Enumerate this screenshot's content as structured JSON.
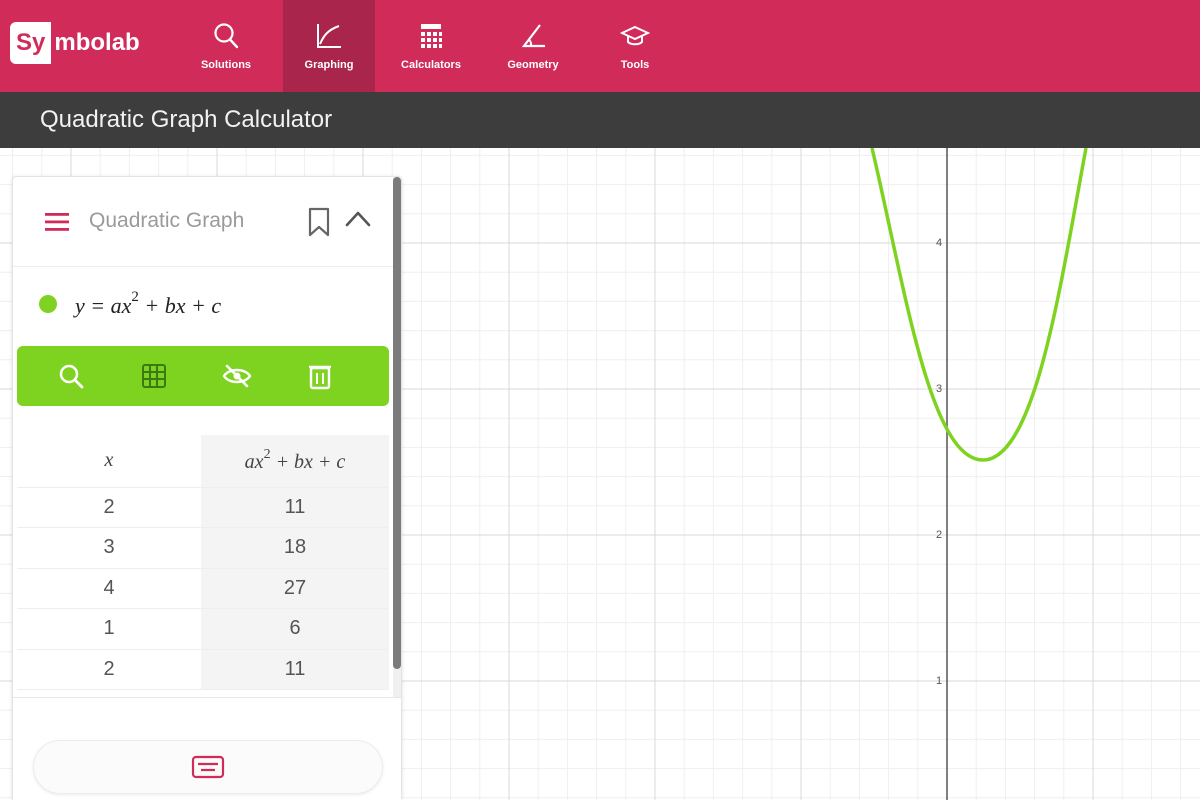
{
  "brand": {
    "logo_box": "Sy",
    "logo_rest": "mbolab",
    "primary_color": "#d12b5a",
    "accent_color": "#7ed321"
  },
  "nav": {
    "items": [
      {
        "label": "Solutions",
        "icon": "search-icon",
        "active": false
      },
      {
        "label": "Graphing",
        "icon": "graph-icon",
        "active": true
      },
      {
        "label": "Calculators",
        "icon": "calculator-icon",
        "active": false
      },
      {
        "label": "Geometry",
        "icon": "geometry-icon",
        "active": false
      },
      {
        "label": "Tools",
        "icon": "graduation-cap-icon",
        "active": false
      }
    ]
  },
  "page": {
    "title": "Quadratic Graph Calculator"
  },
  "panel": {
    "title": "Quadratic Graph",
    "expression": {
      "lhs": "y = ax",
      "exp": "2",
      "rhs": " + bx + c",
      "color": "#7ed321"
    },
    "toolbar": [
      "zoom-icon",
      "table-icon",
      "hide-icon",
      "delete-icon"
    ],
    "table": {
      "headers": {
        "x": "x",
        "y_base": "ax",
        "y_exp": "2",
        "y_rest": " + bx + c"
      },
      "rows": [
        {
          "x": "2",
          "y": "11"
        },
        {
          "x": "3",
          "y": "18"
        },
        {
          "x": "4",
          "y": "27"
        },
        {
          "x": "1",
          "y": "6"
        },
        {
          "x": "2",
          "y": "11"
        }
      ]
    }
  },
  "graph": {
    "y_ticks": [
      "4",
      "3",
      "2",
      "1"
    ],
    "curve_color": "#7ed321"
  }
}
